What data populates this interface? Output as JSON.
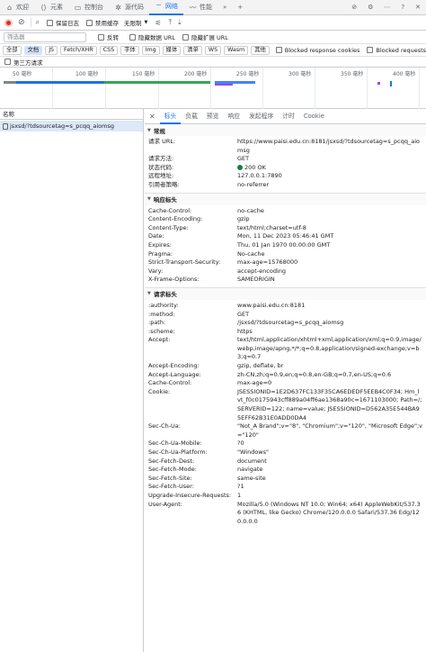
{
  "tabs": [
    {
      "icon": "home-icon",
      "label": "欢迎"
    },
    {
      "icon": "elements-icon",
      "label": "元素"
    },
    {
      "icon": "console-icon",
      "label": "控制台"
    },
    {
      "icon": "sources-icon",
      "label": "源代码"
    },
    {
      "icon": "wifi-icon",
      "label": "网络"
    },
    {
      "icon": "performance-icon",
      "label": "性能"
    }
  ],
  "toolbar": {
    "preserve_log": "保留日志",
    "disable_cache": "禁用缓存",
    "throttle": "无限制"
  },
  "filter": {
    "placeholder": "筛选器",
    "invert": "反转",
    "hide_data_urls": "隐藏数据 URL",
    "hide_extension_urls": "隐藏扩展 URL"
  },
  "type_filters": [
    "全部",
    "文档",
    "JS",
    "Fetch/XHR",
    "CSS",
    "字体",
    "Img",
    "媒体",
    "清单",
    "WS",
    "Wasm",
    "其他"
  ],
  "blocked_response_cookies": "Blocked response cookies",
  "blocked_requests": "Blocked requests",
  "third_party": "第三方请求",
  "timeline_ticks": [
    "50 毫秒",
    "100 毫秒",
    "150 毫秒",
    "200 毫秒",
    "250 毫秒",
    "300 毫秒",
    "350 毫秒",
    "400 毫秒"
  ],
  "name_header": "名称",
  "request_name": "jsxsd/?tdsourcetag=s_pcqq_aiomsg",
  "detail_tabs": [
    "标头",
    "负载",
    "预览",
    "响应",
    "发起程序",
    "计时",
    "Cookie"
  ],
  "general": {
    "title": "常规",
    "rows": [
      {
        "k": "请求 URL:",
        "v": "https://www.paisi.edu.cn:8181/jsxsd/?tdsourcetag=s_pcqq_aiomsg"
      },
      {
        "k": "请求方法:",
        "v": "GET"
      },
      {
        "k": "状态代码:",
        "v": "200 OK"
      },
      {
        "k": "远程地址:",
        "v": "127.0.0.1:7890"
      },
      {
        "k": "引用者策略:",
        "v": "no-referrer"
      }
    ]
  },
  "response_headers": {
    "title": "响应标头",
    "rows": [
      {
        "k": "Cache-Control:",
        "v": "no-cache"
      },
      {
        "k": "Content-Encoding:",
        "v": "gzip"
      },
      {
        "k": "Content-Type:",
        "v": "text/html;charset=utf-8"
      },
      {
        "k": "Date:",
        "v": "Mon, 11 Dec 2023 05:46:41 GMT"
      },
      {
        "k": "Expires:",
        "v": "Thu, 01 Jan 1970 00:00:00 GMT"
      },
      {
        "k": "Pragma:",
        "v": "No-cache"
      },
      {
        "k": "Strict-Transport-Security:",
        "v": "max-age=15768000"
      },
      {
        "k": "Vary:",
        "v": "accept-encoding"
      },
      {
        "k": "X-Frame-Options:",
        "v": "SAMEORIGIN"
      }
    ]
  },
  "request_headers": {
    "title": "请求标头",
    "rows": [
      {
        "k": ":authority:",
        "v": "www.paisi.edu.cn:8181"
      },
      {
        "k": ":method:",
        "v": "GET"
      },
      {
        "k": ":path:",
        "v": "/jsxsd/?tdsourcetag=s_pcqq_aiomsg"
      },
      {
        "k": ":scheme:",
        "v": "https"
      },
      {
        "k": "Accept:",
        "v": "text/html,application/xhtml+xml,application/xml;q=0.9,image/webp,image/apng,*/*;q=0.8,application/signed-exchange;v=b3;q=0.7"
      },
      {
        "k": "Accept-Encoding:",
        "v": "gzip, deflate, br"
      },
      {
        "k": "Accept-Language:",
        "v": "zh-CN,zh;q=0.9,en;q=0.8,en-GB;q=0.7,en-US;q=0.6"
      },
      {
        "k": "Cache-Control:",
        "v": "max-age=0"
      },
      {
        "k": "Cookie:",
        "v": "JSESSIONID=1E2D637FC133F35CA6EDEDF5EEB4C0F34; Hm_lvt_f0c0175943cff889a04ff6ae1368a90c=1671103000; Path=/; SERVERID=122; name=value; JSESSIONID=D562A35E544BA95EFF62B31E0ADD0DA4"
      },
      {
        "k": "Sec-Ch-Ua:",
        "v": "\"Not_A Brand\";v=\"8\", \"Chromium\";v=\"120\", \"Microsoft Edge\";v=\"120\""
      },
      {
        "k": "Sec-Ch-Ua-Mobile:",
        "v": "?0"
      },
      {
        "k": "Sec-Ch-Ua-Platform:",
        "v": "\"Windows\""
      },
      {
        "k": "Sec-Fetch-Dest:",
        "v": "document"
      },
      {
        "k": "Sec-Fetch-Mode:",
        "v": "navigate"
      },
      {
        "k": "Sec-Fetch-Site:",
        "v": "same-site"
      },
      {
        "k": "Sec-Fetch-User:",
        "v": "?1"
      },
      {
        "k": "Upgrade-Insecure-Requests:",
        "v": "1"
      },
      {
        "k": "User-Agent:",
        "v": "Mozilla/5.0 (Windows NT 10.0; Win64; x64) AppleWebKit/537.36 (KHTML, like Gecko) Chrome/120.0.0.0 Safari/537.36 Edg/120.0.0.0"
      }
    ]
  },
  "colors": {
    "accent": "#1a73e8",
    "status_ok": "#188038",
    "record": "#d93025",
    "selected_row": "#dde8f8"
  }
}
